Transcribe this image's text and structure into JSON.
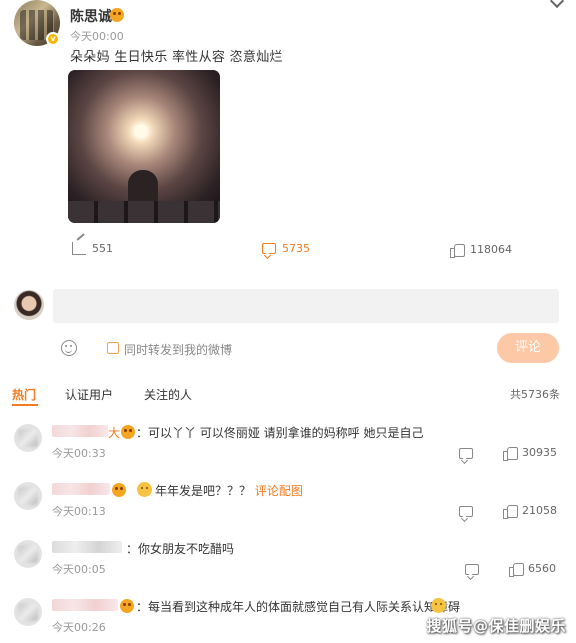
{
  "post": {
    "username": "陈思诚",
    "time": "今天00:00",
    "text": "朵朵妈 生日快乐 率性从容 恣意灿烂",
    "verified_mark": "v",
    "stats": {
      "repost": "551",
      "comment": "5735",
      "like": "118064"
    }
  },
  "compose": {
    "placeholder": "",
    "repost_label": "同时转发到我的微博",
    "submit_label": "评论"
  },
  "tabs": [
    {
      "label": "热门"
    },
    {
      "label": "认证用户"
    },
    {
      "label": "关注的人"
    }
  ],
  "total_comments": "共5736条",
  "comments": [
    {
      "suffix": "大",
      "text": "：可以丫丫 可以佟丽娅 请别拿谁的妈称呼 她只是自己",
      "time": "今天00:33",
      "likes": "30935"
    },
    {
      "text": "年年发是吧？？？",
      "pic_link": "评论配图",
      "time": "今天00:13",
      "likes": "21058"
    },
    {
      "text": "：你女朋友不吃醋吗",
      "time": "今天00:05",
      "likes": "6560"
    },
    {
      "text": "：每当看到这种成年人的体面就感觉自己有人际关系认知障碍",
      "time": "今天00:26"
    }
  ],
  "watermark": "搜狐号@保佳删娱乐"
}
